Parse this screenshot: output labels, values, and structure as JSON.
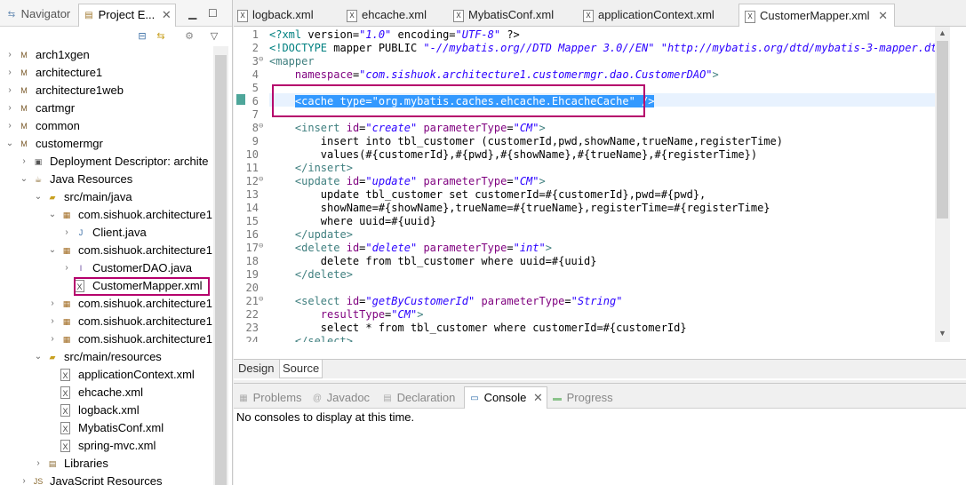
{
  "left_panel": {
    "tabs": [
      {
        "label": "Navigator",
        "icon": "navigator-icon"
      },
      {
        "label": "Project E...",
        "icon": "project-explorer-icon"
      }
    ],
    "tree": [
      {
        "label": "arch1xgen",
        "icon": "project-icon"
      },
      {
        "label": "architecture1",
        "icon": "project-icon"
      },
      {
        "label": "architecture1web",
        "icon": "project-icon"
      },
      {
        "label": "cartmgr",
        "icon": "project-icon"
      },
      {
        "label": "common",
        "icon": "project-icon"
      },
      {
        "label": "customermgr",
        "icon": "project-icon"
      },
      {
        "label": "Deployment Descriptor: archite",
        "icon": "deployment-descriptor-icon"
      },
      {
        "label": "Java Resources",
        "icon": "java-resources-icon"
      },
      {
        "label": "src/main/java",
        "icon": "source-folder-icon"
      },
      {
        "label": "com.sishuok.architecture1",
        "icon": "package-icon"
      },
      {
        "label": "Client.java",
        "icon": "java-file-icon"
      },
      {
        "label": "com.sishuok.architecture1",
        "icon": "package-icon"
      },
      {
        "label": "CustomerDAO.java",
        "icon": "java-interface-icon"
      },
      {
        "label": "CustomerMapper.xml",
        "icon": "xml-file-icon"
      },
      {
        "label": "com.sishuok.architecture1",
        "icon": "package-icon"
      },
      {
        "label": "com.sishuok.architecture1",
        "icon": "package-icon"
      },
      {
        "label": "com.sishuok.architecture1",
        "icon": "package-icon"
      },
      {
        "label": "src/main/resources",
        "icon": "source-folder-icon"
      },
      {
        "label": "applicationContext.xml",
        "icon": "xml-file-icon"
      },
      {
        "label": "ehcache.xml",
        "icon": "xml-file-icon"
      },
      {
        "label": "logback.xml",
        "icon": "xml-file-icon"
      },
      {
        "label": "MybatisConf.xml",
        "icon": "xml-file-icon"
      },
      {
        "label": "spring-mvc.xml",
        "icon": "xml-file-icon"
      },
      {
        "label": "Libraries",
        "icon": "libraries-icon"
      },
      {
        "label": "JavaScript Resources",
        "icon": "javascript-resources-icon"
      }
    ]
  },
  "editor": {
    "tabs": [
      "logback.xml",
      "ehcache.xml",
      "MybatisConf.xml",
      "applicationContext.xml",
      "CustomerMapper.xml"
    ],
    "active_tab": "CustomerMapper.xml",
    "lines": [
      {
        "n": "1",
        "text": "<?xml version=\"1.0\" encoding=\"UTF-8\" ?>"
      },
      {
        "n": "2",
        "text": "<!DOCTYPE mapper PUBLIC \"-//mybatis.org//DTD Mapper 3.0//EN\" \"http://mybatis.org/dtd/mybatis-3-mapper.dtd\">"
      },
      {
        "n": "3",
        "text": "<mapper"
      },
      {
        "n": "4",
        "text": "    namespace=\"com.sishuok.architecture1.customermgr.dao.CustomerDAO\">"
      },
      {
        "n": "5",
        "text": ""
      },
      {
        "n": "6",
        "text": "    <cache type=\"org.mybatis.caches.ehcache.EhcacheCache\" />"
      },
      {
        "n": "7",
        "text": ""
      },
      {
        "n": "8",
        "text": "    <insert id=\"create\" parameterType=\"CM\">"
      },
      {
        "n": "9",
        "text": "        insert into tbl_customer (customerId,pwd,showName,trueName,registerTime)"
      },
      {
        "n": "10",
        "text": "        values(#{customerId},#{pwd},#{showName},#{trueName},#{registerTime})"
      },
      {
        "n": "11",
        "text": "    </insert>"
      },
      {
        "n": "12",
        "text": "    <update id=\"update\" parameterType=\"CM\">"
      },
      {
        "n": "13",
        "text": "        update tbl_customer set customerId=#{customerId},pwd=#{pwd},"
      },
      {
        "n": "14",
        "text": "        showName=#{showName},trueName=#{trueName},registerTime=#{registerTime}"
      },
      {
        "n": "15",
        "text": "        where uuid=#{uuid}"
      },
      {
        "n": "16",
        "text": "    </update>"
      },
      {
        "n": "17",
        "text": "    <delete id=\"delete\" parameterType=\"int\">"
      },
      {
        "n": "18",
        "text": "        delete from tbl_customer where uuid=#{uuid}"
      },
      {
        "n": "19",
        "text": "    </delete>"
      },
      {
        "n": "20",
        "text": ""
      },
      {
        "n": "21",
        "text": "    <select id=\"getByCustomerId\" parameterType=\"String\""
      },
      {
        "n": "22",
        "text": "        resultType=\"CM\">"
      },
      {
        "n": "23",
        "text": "        select * from tbl_customer where customerId=#{customerId}"
      },
      {
        "n": "24",
        "text": "    </select>"
      }
    ],
    "mode_tabs": [
      "Design",
      "Source"
    ],
    "active_mode": "Source"
  },
  "bottom_panel": {
    "tabs": [
      "Problems",
      "Javadoc",
      "Declaration",
      "Console",
      "Progress"
    ],
    "active_tab": "Console",
    "message": "No consoles to display at this time."
  },
  "colors": {
    "highlight_border": "#b5006c",
    "selection": "#3399ff",
    "current_line": "#e8f2fe"
  }
}
